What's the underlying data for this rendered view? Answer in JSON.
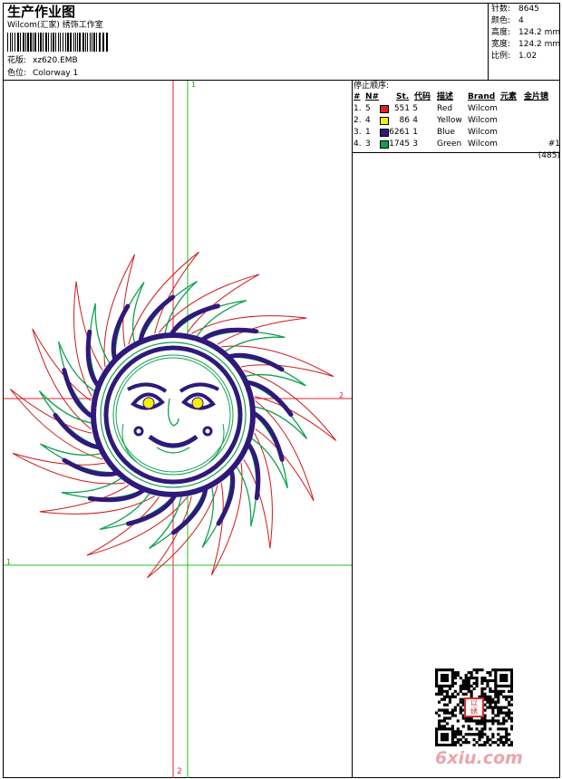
{
  "header": {
    "title": "生产作业图",
    "company": "Wilcom(汇家) 绣饰工作室",
    "design_label": "花版:",
    "design_value": "xz620.EMB",
    "colorway_label": "色位:",
    "colorway_value": "Colorway 1"
  },
  "stats": [
    {
      "label": "针数:",
      "value": "8645"
    },
    {
      "label": "颜色:",
      "value": "4"
    },
    {
      "label": "高度:",
      "value": "124.2 mm"
    },
    {
      "label": "宽度:",
      "value": "124.2 mm"
    },
    {
      "label": "比例:",
      "value": "1.02"
    }
  ],
  "stop_sequence": {
    "title": "停止顺序:",
    "headers": {
      "stop": "#",
      "n": "N#",
      "st": "St.",
      "code": "代码",
      "desc": "描述",
      "brand": "Brand",
      "element": "元素",
      "metallic": "金片镜"
    },
    "rows": [
      {
        "stop": "1.",
        "n": "5",
        "st": "551",
        "code": "5",
        "desc": "Red",
        "brand": "Wilcom",
        "extra": "",
        "color": "#e02020"
      },
      {
        "stop": "2.",
        "n": "4",
        "st": "86",
        "code": "4",
        "desc": "Yellow",
        "brand": "Wilcom",
        "extra": "",
        "color": "#f4f000"
      },
      {
        "stop": "3.",
        "n": "1",
        "st": "6261",
        "code": "1",
        "desc": "Blue",
        "brand": "Wilcom",
        "extra": "",
        "color": "#2e1a7a"
      },
      {
        "stop": "4.",
        "n": "3",
        "st": "1745",
        "code": "3",
        "desc": "Green",
        "brand": "Wilcom",
        "extra": "#1 (485)",
        "color": "#10a050"
      }
    ]
  },
  "guides": {
    "top_marker": "1",
    "right_marker": "2",
    "left_marker": "1",
    "bottom_marker": "2"
  },
  "watermark": {
    "text": "6xiu.com",
    "stamp_text": "以绣"
  },
  "colors": {
    "red_guide": "#e02030",
    "green_guide": "#20c020",
    "thread_blue": "#2e1a7a",
    "thread_green": "#10a050",
    "thread_red": "#d01818",
    "thread_yellow": "#f4f000"
  }
}
